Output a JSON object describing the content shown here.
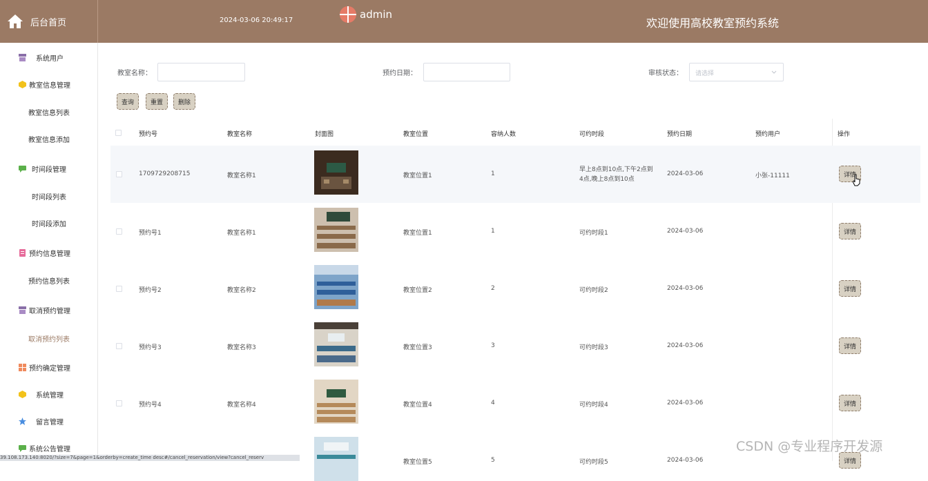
{
  "header": {
    "home_label": "后台首页",
    "datetime": "2024-03-06 20:49:17",
    "user": "admin",
    "welcome": "欢迎使用高校教室预约系统",
    "color": "#9b7a64"
  },
  "sidebar": {
    "items": [
      {
        "label": "系统用户",
        "icon": "box-icon",
        "type": "group"
      },
      {
        "label": "教室信息管理",
        "icon": "cube-icon",
        "type": "group"
      },
      {
        "label": "教室信息列表",
        "type": "sub"
      },
      {
        "label": "教室信息添加",
        "type": "sub"
      },
      {
        "label": "时间段管理",
        "icon": "chat-icon",
        "type": "group"
      },
      {
        "label": "时间段列表",
        "type": "sub"
      },
      {
        "label": "时间段添加",
        "type": "sub"
      },
      {
        "label": "预约信息管理",
        "icon": "doc-icon",
        "type": "group"
      },
      {
        "label": "预约信息列表",
        "type": "sub"
      },
      {
        "label": "取消预约管理",
        "icon": "box-icon",
        "type": "group"
      },
      {
        "label": "取消预约列表",
        "type": "sub",
        "active": true
      },
      {
        "label": "预约确定管理",
        "icon": "grid-icon",
        "type": "group"
      },
      {
        "label": "系统管理",
        "icon": "cube-icon",
        "type": "group"
      },
      {
        "label": "留言管理",
        "icon": "star-icon",
        "type": "group"
      },
      {
        "label": "系统公告管理",
        "icon": "chat-icon",
        "type": "group"
      }
    ]
  },
  "search": {
    "classroom_label": "教室名称：",
    "date_label": "预约日期：",
    "status_label": "审核状态：",
    "status_placeholder": "请选择",
    "query": "查询",
    "reset": "重置",
    "delete": "删除"
  },
  "table": {
    "headers": [
      "预约号",
      "教室名称",
      "封面图",
      "教室位置",
      "容纳人数",
      "可约时段",
      "预约日期",
      "预约用户",
      "操作"
    ],
    "detail_label": "详情",
    "rows": [
      {
        "no": "1709729208715",
        "name": "教室名称1",
        "location": "教室位置1",
        "capacity": "1",
        "slot": "早上8点到10点,下午2点到4点,晚上8点到10点",
        "date": "2024-03-06",
        "user": "小张-11111"
      },
      {
        "no": "预约号1",
        "name": "教室名称1",
        "location": "教室位置1",
        "capacity": "1",
        "slot": "可约时段1",
        "date": "2024-03-06",
        "user": ""
      },
      {
        "no": "预约号2",
        "name": "教室名称2",
        "location": "教室位置2",
        "capacity": "2",
        "slot": "可约时段2",
        "date": "2024-03-06",
        "user": ""
      },
      {
        "no": "预约号3",
        "name": "教室名称3",
        "location": "教室位置3",
        "capacity": "3",
        "slot": "可约时段3",
        "date": "2024-03-06",
        "user": ""
      },
      {
        "no": "预约号4",
        "name": "教室名称4",
        "location": "教室位置4",
        "capacity": "4",
        "slot": "可约时段4",
        "date": "2024-03-06",
        "user": ""
      },
      {
        "no": "",
        "name": "",
        "location": "教室位置5",
        "capacity": "5",
        "slot": "可约时段5",
        "date": "2024-03-06",
        "user": ""
      }
    ]
  },
  "status_url": "39.108.173.140:8020/?size=7&page=1&orderby=create_time desc#/cancel_reservation/view?cancel_reserv",
  "watermark": "CSDN @专业程序开发源"
}
